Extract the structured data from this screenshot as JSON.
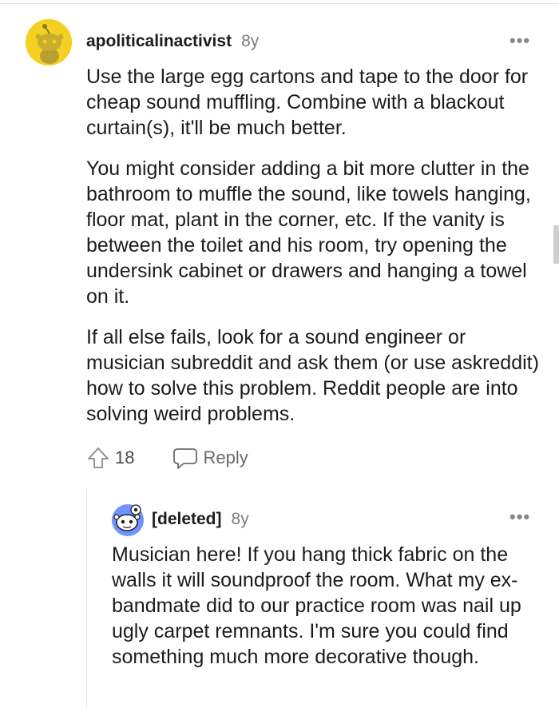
{
  "comments": [
    {
      "username": "apoliticalinactivist",
      "age": "8y",
      "more_label": "•••",
      "paragraphs": [
        "Use the large egg cartons and tape to the door for cheap sound muffling. Combine with a blackout curtain(s), it'll be much better.",
        "You might consider adding a bit more clutter in the bathroom to muffle the sound, like towels hanging, floor mat, plant in the corner, etc. If the vanity is between the toilet and his room, try opening the undersink cabinet or drawers and hanging a towel on it.",
        "If all else fails, look for a sound engineer or musician subreddit and ask them (or use askreddit) how to solve this problem. Reddit people are into solving weird problems."
      ],
      "upvotes": "18",
      "reply_label": "Reply",
      "avatar_color": "#f5d020"
    },
    {
      "username": "[deleted]",
      "age": "8y",
      "more_label": "•••",
      "paragraphs": [
        "Musician here! If you hang thick fabric on the walls it will soundproof the room. What my ex-bandmate did to our practice room was nail up ugly carpet remnants. I'm sure you could find something much more decorative though."
      ],
      "avatar_color": "#7193ff"
    }
  ],
  "icons": {
    "upvote": "upvote-arrow-icon",
    "reply": "speech-bubble-icon",
    "more": "more-options-icon"
  }
}
